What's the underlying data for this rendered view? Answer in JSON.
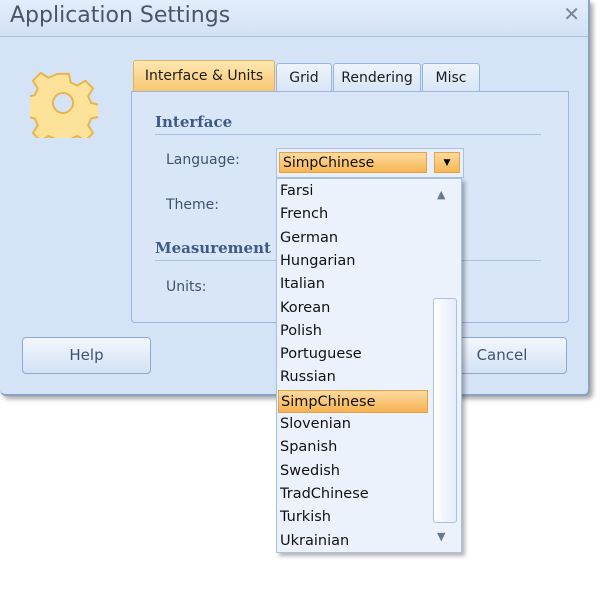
{
  "window": {
    "title": "Application Settings",
    "close_icon": "close-icon"
  },
  "tabs": [
    {
      "label": "Interface & Units",
      "active": true
    },
    {
      "label": "Grid"
    },
    {
      "label": "Rendering"
    },
    {
      "label": "Misc"
    }
  ],
  "interface": {
    "heading": "Interface",
    "language_label": "Language:",
    "language_value": "SimpChinese",
    "theme_label": "Theme:"
  },
  "measurement": {
    "heading": "Measurement",
    "units_label": "Units:"
  },
  "buttons": {
    "help": "Help",
    "cancel": "Cancel"
  },
  "dropdown": {
    "items": [
      "Farsi",
      "French",
      "German",
      "Hungarian",
      "Italian",
      "Korean",
      "Polish",
      "Portuguese",
      "Russian",
      "SimpChinese",
      "Slovenian",
      "Spanish",
      "Swedish",
      "TradChinese",
      "Turkish",
      "Ukrainian"
    ],
    "selected": "SimpChinese"
  },
  "colors": {
    "accent": "#f7b653",
    "background": "#d5e3f6"
  }
}
